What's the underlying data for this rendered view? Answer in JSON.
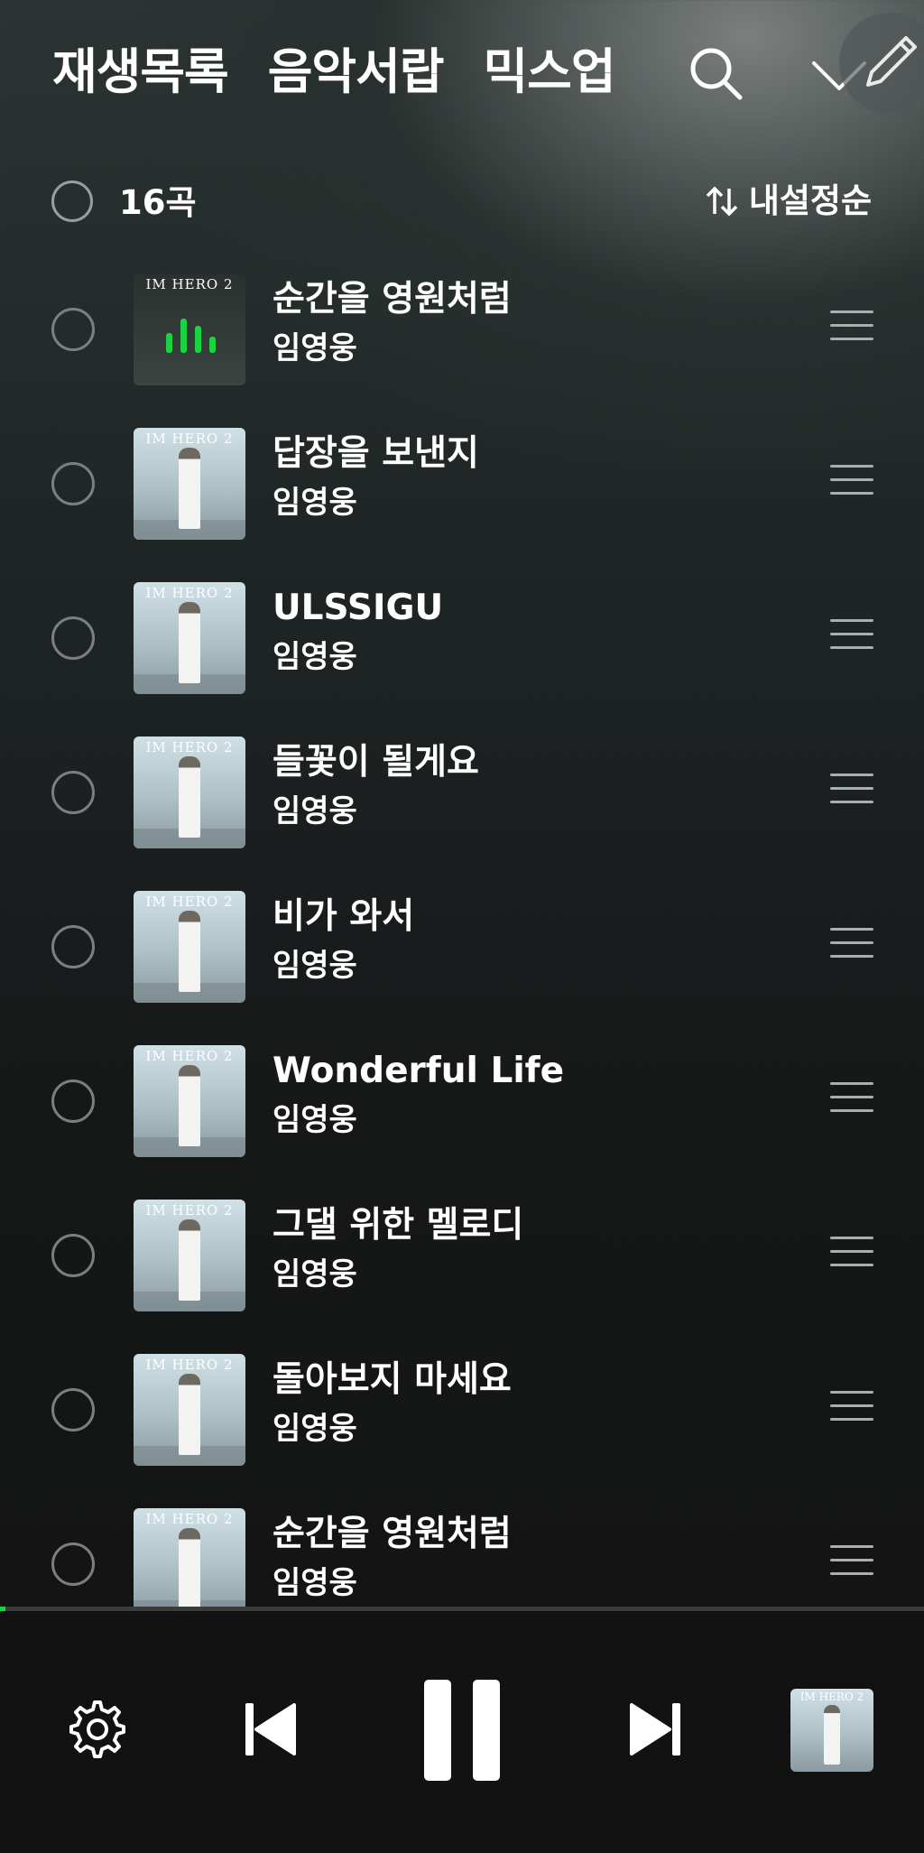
{
  "header": {
    "tabs": [
      "재생목록",
      "음악서랍",
      "믹스업"
    ],
    "selected_count": "16곡",
    "sort_label": "내설정순"
  },
  "songs": [
    {
      "title": "순간을 영원처럼",
      "artist": "임영웅",
      "playing": true
    },
    {
      "title": "답장을 보낸지",
      "artist": "임영웅",
      "playing": false
    },
    {
      "title": "ULSSIGU",
      "artist": "임영웅",
      "playing": false
    },
    {
      "title": "들꽃이 될게요",
      "artist": "임영웅",
      "playing": false
    },
    {
      "title": "비가 와서",
      "artist": "임영웅",
      "playing": false
    },
    {
      "title": "Wonderful Life",
      "artist": "임영웅",
      "playing": false
    },
    {
      "title": "그댈 위한 멜로디",
      "artist": "임영웅",
      "playing": false
    },
    {
      "title": "돌아보지 마세요",
      "artist": "임영웅",
      "playing": false
    },
    {
      "title": "순간을 영원처럼",
      "artist": "임영웅",
      "playing": false
    }
  ],
  "album_art_text": "IM HERO 2",
  "colors": {
    "accent": "#19d343",
    "background": "#121212"
  },
  "player": {
    "progress_fraction": 0.006,
    "icons": [
      "settings-icon",
      "previous-icon",
      "pause-icon",
      "next-icon"
    ]
  }
}
